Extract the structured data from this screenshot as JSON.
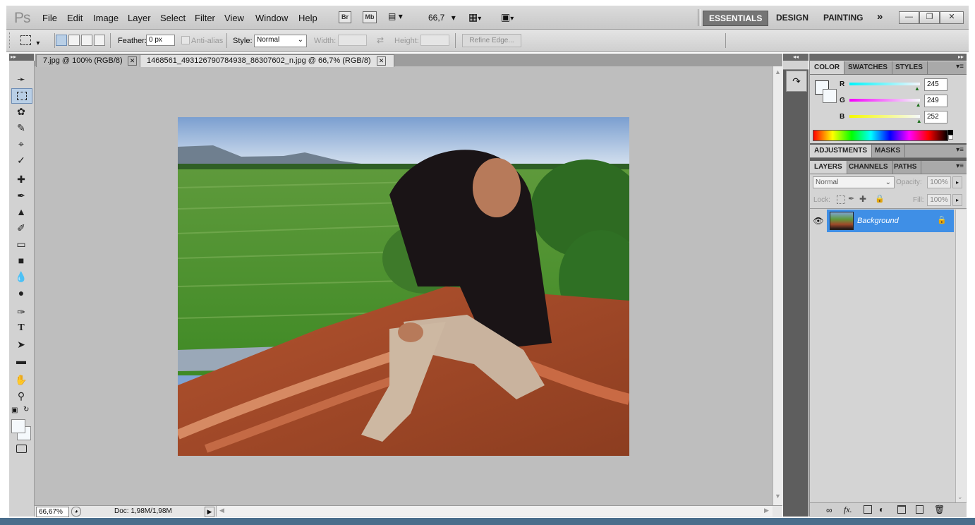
{
  "app": {
    "logo": "Ps",
    "menu": [
      "File",
      "Edit",
      "Image",
      "Layer",
      "Select",
      "Filter",
      "View",
      "Window",
      "Help"
    ],
    "bridge_label": "Br",
    "minibridge_label": "Mb",
    "zoom_value": "66,7",
    "workspaces": [
      "ESSENTIALS",
      "DESIGN",
      "PAINTING"
    ],
    "workspace_more": "»"
  },
  "options_bar": {
    "feather_label": "Feather:",
    "feather_value": "0 px",
    "antialias_label": "Anti-alias",
    "style_label": "Style:",
    "style_value": "Normal",
    "width_label": "Width:",
    "height_label": "Height:",
    "refine_edge_label": "Refine Edge..."
  },
  "documents": {
    "tabs": [
      {
        "label": "7.jpg @ 100% (RGB/8)"
      },
      {
        "label": "1468561_493126790784938_86307602_n.jpg @ 66,7% (RGB/8)"
      }
    ],
    "zoom_field": "66,67%",
    "doc_info": "Doc: 1,98M/1,98M"
  },
  "color_panel": {
    "tabs": [
      "COLOR",
      "SWATCHES",
      "STYLES"
    ],
    "r_label": "R",
    "r_value": "245",
    "g_label": "G",
    "g_value": "249",
    "b_label": "B",
    "b_value": "252",
    "r_fraction": 0.96,
    "g_fraction": 0.976,
    "b_fraction": 0.988
  },
  "adjustments_panel": {
    "tabs": [
      "ADJUSTMENTS",
      "MASKS"
    ]
  },
  "layers_panel": {
    "tabs": [
      "LAYERS",
      "CHANNELS",
      "PATHS"
    ],
    "blend_mode": "Normal",
    "opacity_label": "Opacity:",
    "opacity_value": "100%",
    "lock_label": "Lock:",
    "fill_label": "Fill:",
    "fill_value": "100%",
    "layer_name": "Background"
  },
  "colors": {
    "accent_selected": "#3f8fe6",
    "r_slider": "#22d0d0",
    "g_slider": "#e020e0",
    "b_slider": "#e4e420"
  }
}
